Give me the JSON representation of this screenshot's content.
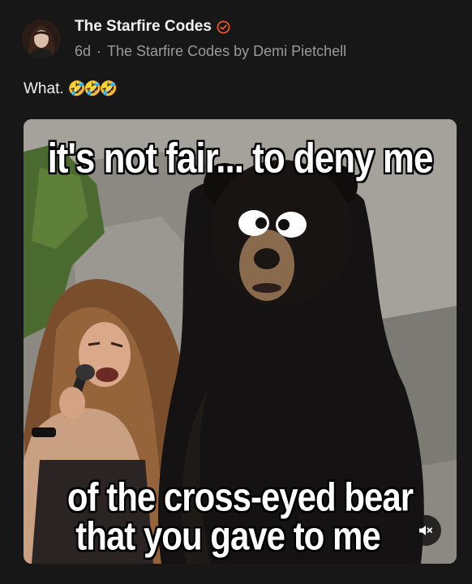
{
  "post": {
    "author": "The Starfire Codes",
    "time": "6d",
    "separator": "·",
    "source": "The Starfire Codes by Demi Pietchell",
    "caption_text": "What.",
    "caption_emoji": "🤣🤣🤣"
  },
  "meme": {
    "top_text": "it's not fair... to deny me",
    "bottom_line1": "of the cross-eyed bear",
    "bottom_line2": "that you gave to me"
  },
  "icons": {
    "verified": "verified-badge-icon",
    "mute": "speaker-muted-icon"
  },
  "colors": {
    "background": "#171717",
    "verified_badge": "#f05a28",
    "meta_text": "#9a9a9a"
  }
}
